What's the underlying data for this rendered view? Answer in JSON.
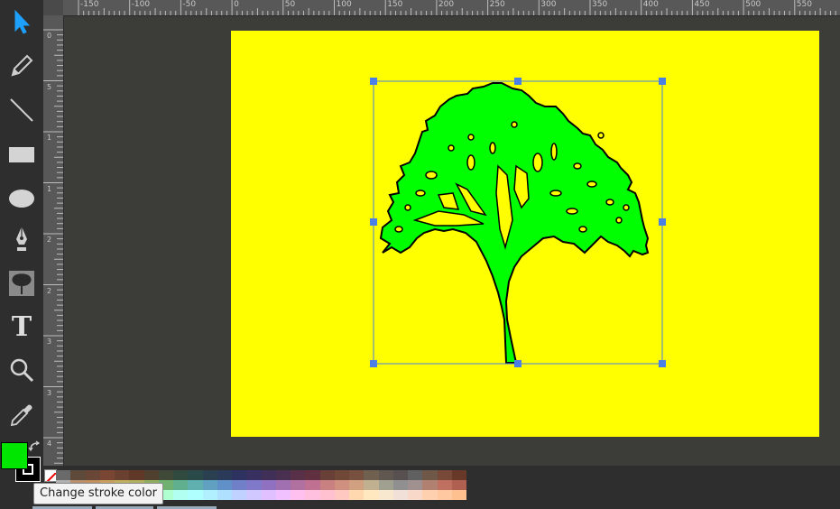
{
  "toolbar": {
    "tools": [
      {
        "id": "select",
        "icon": "select-arrow-icon"
      },
      {
        "id": "pencil",
        "icon": "pencil-icon"
      },
      {
        "id": "line",
        "icon": "line-icon"
      },
      {
        "id": "rectangle",
        "icon": "rectangle-icon"
      },
      {
        "id": "ellipse",
        "icon": "ellipse-icon"
      },
      {
        "id": "pen",
        "icon": "pen-nib-icon"
      },
      {
        "id": "image",
        "icon": "tree-image-icon"
      },
      {
        "id": "text",
        "icon": "text-icon"
      },
      {
        "id": "zoom",
        "icon": "magnifier-icon"
      },
      {
        "id": "eyedropper",
        "icon": "eyedropper-icon"
      }
    ],
    "text_tool_glyph": "T"
  },
  "ruler": {
    "top_labels": [
      "-150",
      "-100",
      "-50",
      "0",
      "50",
      "100",
      "150",
      "200",
      "250",
      "300",
      "350",
      "400",
      "450",
      "500",
      "550"
    ],
    "left_labels": [
      "0",
      "5",
      "1",
      "1",
      "2",
      "2",
      "3",
      "3",
      "4",
      "4"
    ]
  },
  "canvas": {
    "background": "#ffff00",
    "object": {
      "name": "tree",
      "fill": "#00ff00",
      "stroke": "#000000"
    },
    "selection_color": "#4a7fe8"
  },
  "colors": {
    "fill": "#00e600",
    "stroke": "#000000"
  },
  "tooltip": {
    "text": "Change stroke color"
  },
  "palette": {
    "rows": [
      [
        "#6a6a6a",
        "#5e4a3a",
        "#6a4636",
        "#7a4634",
        "#6a4030",
        "#603828",
        "#504030",
        "#404838",
        "#304a40",
        "#2a4a4a",
        "#2a4050",
        "#2a3a58",
        "#2e3260",
        "#383060",
        "#403058",
        "#4a3050",
        "#583048",
        "#603040",
        "#684038",
        "#704838",
        "#785040",
        "#706050",
        "#605850",
        "#585050",
        "#606060",
        "#705848",
        "#784838",
        "#683828"
      ],
      [
        "#b0b0b0",
        "#b89070",
        "#c09060",
        "#c8a060",
        "#c0b060",
        "#b0b060",
        "#90b060",
        "#70b070",
        "#60b090",
        "#60b0b0",
        "#60a0c0",
        "#6090c8",
        "#7080c8",
        "#8078c8",
        "#9070c0",
        "#a070b0",
        "#b070a0",
        "#c07090",
        "#c88080",
        "#d09080",
        "#d0a080",
        "#c0b090",
        "#a0a090",
        "#909090",
        "#a09090",
        "#b08070",
        "#c07060",
        "#b06050"
      ],
      [
        "#ffffff",
        "#ffe0b0",
        "#fff0a0",
        "#ffffa0",
        "#f0ffa0",
        "#e0ffa0",
        "#c0ffb0",
        "#b0ffd0",
        "#b0fff0",
        "#b0ffff",
        "#b0f0ff",
        "#b0e0ff",
        "#c0d0ff",
        "#d0c8ff",
        "#e0c0ff",
        "#f0c0ff",
        "#ffc0f0",
        "#ffc0e0",
        "#ffc0d0",
        "#ffc8c0",
        "#ffd8b0",
        "#ffe8c0",
        "#f8e8d0",
        "#f0e0d8",
        "#f8d8c8",
        "#ffd0b0",
        "#ffc8a0",
        "#ffc090"
      ]
    ]
  }
}
